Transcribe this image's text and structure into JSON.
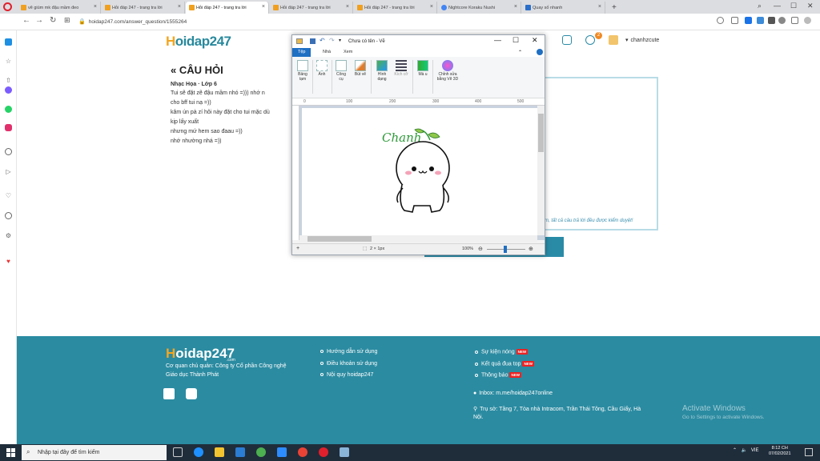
{
  "browser": {
    "tabs": [
      {
        "label": "vẽ giùm mk đậu mầm đeo",
        "color": "#f0a020"
      },
      {
        "label": "Hỏi đáp 247 - trang tra lời",
        "color": "#f0a020"
      },
      {
        "label": "Hỏi đáp 247 - trang tra lời",
        "color": "#f0a020"
      },
      {
        "label": "Hỏi đáp 247 - trang tra lời",
        "color": "#f0a020"
      },
      {
        "label": "Hỏi đáp 247 - trang tra lời",
        "color": "#f0a020"
      },
      {
        "label": "Nightcore Koraku Nushi",
        "color": "#4285f4"
      },
      {
        "label": "Quay số nhanh",
        "color": "#2a6fc9"
      }
    ],
    "new_tab": "+",
    "url": "hoidap247.com/answer_question/1555264"
  },
  "site": {
    "logo_h": "H",
    "logo_rest": "oidap247",
    "user_name": "chanhzcute",
    "notif_count": "2"
  },
  "question": {
    "title": "« CÂU HỎI",
    "subject": "Nhạc Họa · Lớp 6",
    "lines": [
      "Tui sẽ đặt zẽ đậu mầm nhó =))) nhớ n",
      "cho bff tui nạ =))",
      "kâm ún pà zí hôi này đặt cho tui mặc dù",
      "kịp lấy xuất",
      "nhưng mứ hem sao đaau =))",
      "nhớ nhường nhá =))"
    ]
  },
  "answer_note": "m, tất cả câu trả lời đều được kiểm duyệt!",
  "paint": {
    "title": "Chưa có tên - Vẽ",
    "menu": [
      "Tệp",
      "Nhà",
      "Xem"
    ],
    "tools": [
      {
        "label": "Bảng tạm"
      },
      {
        "label": "Ảnh"
      },
      {
        "label": "Công cụ"
      },
      {
        "label": "Bút vẽ"
      },
      {
        "label": "Hình dạng"
      },
      {
        "label": "Kích cỡ"
      },
      {
        "label": "Mà u"
      },
      {
        "label": "Chỉnh sửa bằng Vẽ 3D"
      }
    ],
    "ruler": [
      "0",
      "100",
      "200",
      "300",
      "400",
      "500"
    ],
    "canvas_text": "Chanh",
    "status_size": "2 × 1px",
    "zoom": "100%"
  },
  "footer": {
    "logo_h": "H",
    "logo_rest": "oidap247",
    "logo_com": ".com",
    "org_line1": "Cơ quan chủ quản: Công ty Cổ phần Công nghệ",
    "org_line2": "Giáo dục Thành Phát",
    "links": [
      "Hướng dẫn sử dụng",
      "Điều khoản sử dụng",
      "Nội quy hoidap247"
    ],
    "news": [
      {
        "label": "Sự kiện nóng",
        "badge": "NEW"
      },
      {
        "label": "Kết quả đua top",
        "badge": "NEW"
      },
      {
        "label": "Thông báo",
        "badge": "NEW"
      }
    ],
    "inbox": "Inbox: m.me/hoidap247online",
    "address_line1": "Trụ sở: Tầng 7, Tòa nhà Intracom, Trần Thái Tông, Cầu Giấy, Hà",
    "address_line2": "Nội."
  },
  "watermark": {
    "line1": "Activate Windows",
    "line2": "Go to Settings to activate Windows."
  },
  "taskbar": {
    "search_placeholder": "Nhập tại đây để tìm kiếm",
    "lang": "VIE",
    "time": "8:12 CH",
    "date": "07/02/2021"
  }
}
